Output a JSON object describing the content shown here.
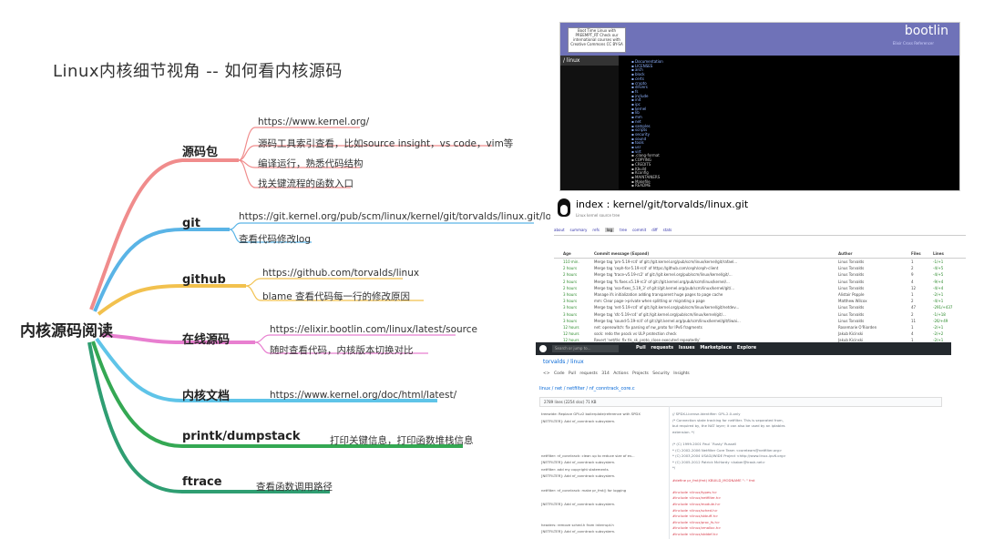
{
  "title": "Linux内核细节视角 -- 如何看内核源码",
  "root": "内核源码阅读",
  "branches": [
    {
      "label": "源码包",
      "leaves": [
        "https://www.kernel.org/",
        "源码工具索引查看，比如source insight，vs code，vim等",
        "编译运行，熟悉代码结构",
        "找关键流程的函数入口"
      ]
    },
    {
      "label": "git",
      "leaves": [
        "https://git.kernel.org/pub/scm/linux/kernel/git/torvalds/linux.git/log/",
        "查看代码修改log"
      ]
    },
    {
      "label": "github",
      "leaves": [
        "https://github.com/torvalds/linux",
        "blame 查看代码每一行的修改原因"
      ]
    },
    {
      "label": "在线源码",
      "leaves": [
        "https://elixir.bootlin.com/linux/latest/source",
        "随时查看代码，内核版本切换对比"
      ]
    },
    {
      "label": "内核文档",
      "leaves": [
        "https://www.kernel.org/doc/html/latest/"
      ]
    },
    {
      "label": "printk/dumpstack",
      "leaves": [
        "打印关键信息，打印函数堆栈信息"
      ]
    },
    {
      "label": "ftrace",
      "leaves": [
        "查看函数调用路径"
      ]
    }
  ],
  "colors": {
    "branch_red": "#f08c8c",
    "branch_blue": "#5ab4e6",
    "branch_yellow": "#f2c14e",
    "branch_pink": "#e87fd0",
    "branch_cyan": "#5fc4e8",
    "branch_green": "#34a853",
    "branch_teal": "#2f9e72"
  },
  "shots": {
    "elixir": {
      "brand": "bootlin",
      "subtitle": "Elixir Cross Referencer",
      "badge": "Boot Time Linux with PREEMPT_RT Check our international courses with Creative Commons CC BY-SA",
      "side_header": "/ linux",
      "files": [
        "Documentation",
        "LICENSES",
        "arch",
        "block",
        "certs",
        "crypto",
        "drivers",
        "fs",
        "include",
        "init",
        "ipc",
        "kernel",
        "lib",
        "mm",
        "net",
        "samples",
        "scripts",
        "security",
        "sound",
        "tools",
        "usr",
        "virt",
        ".clang-format",
        "COPYING",
        "CREDITS",
        "Kbuild",
        "Kconfig",
        "MAINTAINERS",
        "Makefile",
        "README"
      ]
    },
    "cgit": {
      "title": "index : kernel/git/torvalds/linux.git",
      "subtitle": "Linux kernel source tree",
      "tabs": [
        "about",
        "summary",
        "refs",
        "log",
        "tree",
        "commit",
        "diff",
        "stats"
      ],
      "header": [
        "Age",
        "Commit message (Expand)",
        "Author",
        "Files",
        "Lines"
      ],
      "rows": [
        [
          "110 min.",
          "Merge tag 'pm-5.19-rc4' of git://git.kernel.org/pub/scm/linux/kernel/git/rafael...",
          "Linus Torvalds",
          "1",
          "-1/+1"
        ],
        [
          "2 hours",
          "Merge tag 'ceph-for-5.19-rc4' of https://github.com/ceph/ceph-client",
          "Linus Torvalds",
          "2",
          "-4/+5"
        ],
        [
          "2 hours",
          "Merge tag 'trace-v5.19-rc2' of git://git.kernel.org/pub/scm/linux/kernel/git/...",
          "Linus Torvalds",
          "9",
          "-4/+5"
        ],
        [
          "2 hours",
          "Merge tag 'fs.fixes.v5.19-rc3' of git://git.kernel.org/pub/scm/linux/kernel/...",
          "Linus Torvalds",
          "4",
          "-9/+4"
        ],
        [
          "2 hours",
          "Merge tag 'xsa-fixes_5.19_3' of git://git.kernel.org/pub/scm/linux/kernel/git/...",
          "Linus Torvalds",
          "12",
          "-4/+4"
        ],
        [
          "3 hours",
          "Manage ifs initialization adding transparent huge pages to page cache",
          "Alistair Popple",
          "1",
          "-2/+1"
        ],
        [
          "3 hours",
          "mm: Clear page->private when splitting or migrating a page",
          "Matthew Wilcox",
          "2",
          "-4/+1"
        ],
        [
          "3 hours",
          "Merge tag 'net-5.19-rc4' of git://git.kernel.org/pub/scm/linux/kernel/git/netdev...",
          "Linus Torvalds",
          "47",
          "-291/+437"
        ],
        [
          "3 hours",
          "Merge tag 'sfc-5.19-rc4' of git://git.kernel.org/pub/scm/linux/kernel/git/...",
          "Linus Torvalds",
          "2",
          "-1/+18"
        ],
        [
          "3 hours",
          "Merge tag 'sound-5.19-rc4' of git://git.kernel.org/pub/scm/linux/kernel/git/tiwai...",
          "Linus Torvalds",
          "11",
          "-26/+49"
        ],
        [
          "12 hours",
          "net: openswitch: fix parsing of nw_proto for IPv6 fragments",
          "Rosemarie O'Riorden",
          "1",
          "-2/+1"
        ],
        [
          "12 hours",
          "sock: redo the psock vs ULP protection check",
          "Jakub Kicinski",
          "4",
          "-2/+2"
        ],
        [
          "12 hours",
          "Revert 'net/tls: fix tls_sk_proto_close executed repeatedly'",
          "Jakub Kicinski",
          "1",
          "-2/+1"
        ]
      ]
    },
    "github": {
      "search": "Search or jump to...",
      "nav": "Pull requests  Issues  Marketplace  Explore",
      "repo": "torvalds / linux",
      "tabs": "<> Code   Pull requests 314   Actions   Projects   Security   Insights",
      "path": "linux / net / netfilter / nf_conntrack_core.c",
      "info": "2789 lines (2254 sloc)  71 KB",
      "blame": [
        "treewide: Replace GPLv2 boilerplate/reference with SPDX",
        "[NETFILTER]: Add nf_conntrack subsystem.",
        "",
        "",
        "",
        "",
        "netfilter: nf_conntrack: clean up to reduce size of ev...",
        "[NETFILTER]: Add nf_conntrack subsystem.",
        "netfilter: add my copyright statements",
        "[NETFILTER]: Add nf_conntrack subsystem.",
        "",
        "netfilter: nf_conntrack: make pr_fmt() for logging",
        "",
        "[NETFILTER]: Add nf_conntrack subsystem.",
        "",
        "",
        "headers: remove sched.h from interrupt.h",
        "[NETFILTER]: Add nf_conntrack subsystem."
      ],
      "code": [
        "// SPDX-License-Identifier: GPL-2.0-only",
        "/* Connection state tracking for netfilter.  This is separated from,",
        "   but required by, the NAT layer; it can also be used by an iptables",
        "   extension. */",
        "",
        "/* (C) 1999-2001 Paul `Rusty' Russell",
        " * (C) 2002-2006 Netfilter Core Team <coreteam@netfilter.org>",
        " * (C) 2003,2004 USAGI/WIDE Project <http://www.linux-ipv6.org>",
        " * (C) 2005-2012 Patrick McHardy <kaber@trash.net>",
        " */",
        "",
        "#define pr_fmt(fmt) KBUILD_MODNAME \": \" fmt",
        "",
        "#include <linux/types.h>",
        "#include <linux/netfilter.h>",
        "#include <linux/module.h>",
        "#include <linux/sched.h>",
        "#include <linux/skbuff.h>",
        "#include <linux/proc_fs.h>",
        "#include <linux/vmalloc.h>",
        "#include <linux/stddef.h>"
      ]
    }
  }
}
